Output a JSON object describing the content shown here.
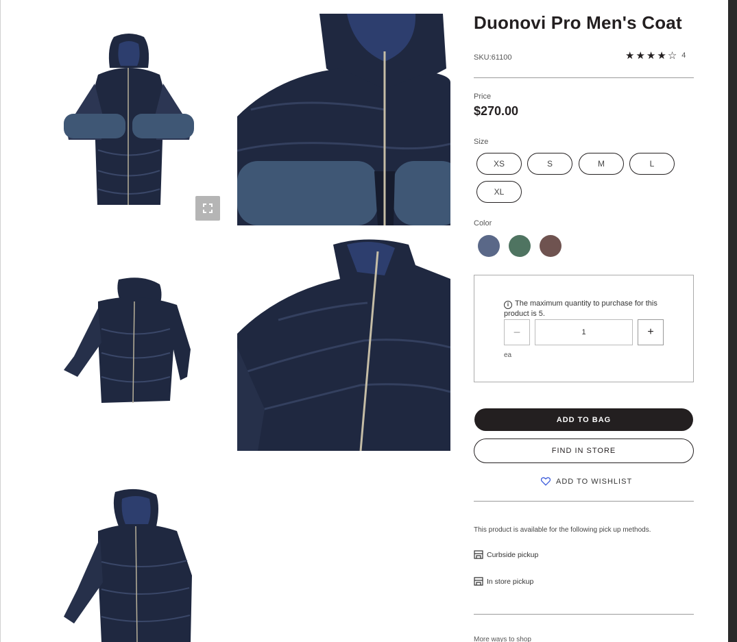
{
  "product": {
    "title": "Duonovi Pro Men's Coat",
    "sku": "SKU:61100",
    "rating_stars": 4,
    "rating_count": "4",
    "price_label": "Price",
    "price": "$270.00"
  },
  "size": {
    "label": "Size",
    "options": [
      "XS",
      "S",
      "M",
      "L",
      "XL"
    ]
  },
  "color": {
    "label": "Color",
    "swatches": [
      "#5a6888",
      "#4f7461",
      "#6f5350"
    ]
  },
  "quantity": {
    "note": "The maximum quantity to purchase for this product is 5.",
    "value": "1",
    "unit": "ea",
    "minus": "−",
    "plus": "+"
  },
  "actions": {
    "add_to_bag": "ADD TO BAG",
    "find_in_store": "FIND IN STORE",
    "add_to_wishlist": "ADD TO WISHLIST"
  },
  "pickup": {
    "intro": "This product is available for the following pick up methods.",
    "methods": [
      "Curbside pickup",
      "In store pickup"
    ]
  },
  "footer": {
    "more_ways": "More ways to shop"
  },
  "colors": {
    "jacket_dark": "#1f2840",
    "jacket_mid": "#2c3653",
    "sleeve_blue": "#3f5775",
    "hood_lining": "#2d3e6e",
    "text_dark": "#231f20"
  },
  "icons": {
    "expand": "expand-icon",
    "info": "info-icon",
    "heart": "heart-icon",
    "store": "store-icon",
    "star": "star-icon"
  }
}
